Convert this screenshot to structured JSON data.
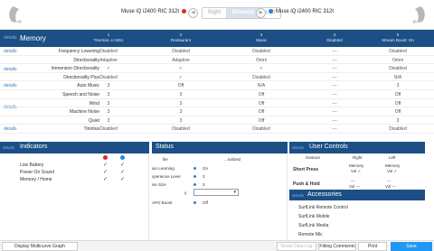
{
  "toolbar": {
    "left_device": "Muse iQ i2400 RIC 312t",
    "right_device": "Muse iQ i2400 RIC 312t",
    "side_right": "Right",
    "side_binaural": "Binaural",
    "side_left": "Left",
    "colors": {
      "left": "#d32f2f",
      "right": "#1e88e5"
    }
  },
  "memory": {
    "link": "details",
    "title": "Memory",
    "columns": [
      {
        "num": "1",
        "name": "*Normal, e-1551"
      },
      {
        "num": "2",
        "name": "Restaurant"
      },
      {
        "num": "3",
        "name": "Music"
      },
      {
        "num": "4",
        "name": "Disabled"
      },
      {
        "num": "5",
        "name": "Stream Boost: On"
      }
    ],
    "rows": [
      {
        "label": "Frequency Lowering",
        "cells": [
          "Disabled",
          "Disabled",
          "Disabled",
          "---",
          "Disabled"
        ]
      },
      {
        "label": "Directionality",
        "cells": [
          "Adaptive",
          "Adaptive",
          "Omni",
          "---",
          "Omni"
        ]
      },
      {
        "label": "Immersion Directionality",
        "cells": [
          "✓",
          "✓",
          "✓",
          "---",
          "Disabled"
        ]
      },
      {
        "label": "Directionality Plus",
        "cells": [
          "Disabled",
          "✓",
          "Disabled",
          "---",
          "N/A"
        ]
      },
      {
        "label": "Auto Music",
        "cells": [
          "3",
          "Off",
          "N/A",
          "---",
          "3"
        ]
      },
      {
        "label": "Speech and Noise",
        "cells": [
          "3",
          "3",
          "Off",
          "---",
          "Off"
        ]
      },
      {
        "label": "Wind",
        "cells": [
          "3",
          "3",
          "Off",
          "---",
          "Off"
        ]
      },
      {
        "label": "Machine Noise",
        "cells": [
          "3",
          "3",
          "Off",
          "---",
          "Off"
        ]
      },
      {
        "label": "Quiet",
        "cells": [
          "3",
          "3",
          "Off",
          "---",
          "3"
        ]
      },
      {
        "label": "Tinnitus",
        "cells": [
          "Disabled",
          "Disabled",
          "Disabled",
          "---",
          "Disabled"
        ]
      }
    ],
    "details_links": [
      "details",
      "details",
      "details",
      "details",
      "details"
    ]
  },
  "indicators": {
    "link": "details",
    "title": "Indicators",
    "rows": [
      {
        "label": "Low Battery",
        "left": "✓",
        "right": "✓"
      },
      {
        "label": "Power On Sound",
        "left": "✓",
        "right": "✓"
      },
      {
        "label": "Memory / Home",
        "left": "✓",
        "right": "✓"
      }
    ]
  },
  "status": {
    "title": "Status",
    "items": [
      {
        "label": "ller",
        "value": "...nalized"
      },
      {
        "label": "ain Learning",
        "value": "On"
      },
      {
        "label": "xperience Level",
        "value": "3"
      },
      {
        "label": "ise Size",
        "value": "3"
      },
      {
        "label": "y",
        "value": ""
      },
      {
        "label": "APO Boost",
        "value": "Off"
      }
    ]
  },
  "user_controls": {
    "link": "details",
    "title": "User Controls",
    "headers": [
      "Gesture",
      "Right",
      "Left"
    ],
    "rows": [
      {
        "gesture": "Short Press",
        "right": "Memory",
        "right2": "Vol ✓",
        "left": "Memory",
        "left2": "Vol ✓"
      },
      {
        "gesture": "Push & Hold",
        "right": "---",
        "right2": "Vol ---",
        "left": "---",
        "left2": "Vol ---"
      }
    ]
  },
  "accessories": {
    "link": "details",
    "title": "Accessories",
    "items": [
      "SurfLink Remote Control",
      "SurfLink Mobile",
      "SurfLink Media",
      "Remote Mic"
    ]
  },
  "footer": {
    "multicurve": "Display Multicurve Graph",
    "reset": "Reset Data Log",
    "comments": "Fitting Comments",
    "print": "Print",
    "save": "Save"
  }
}
